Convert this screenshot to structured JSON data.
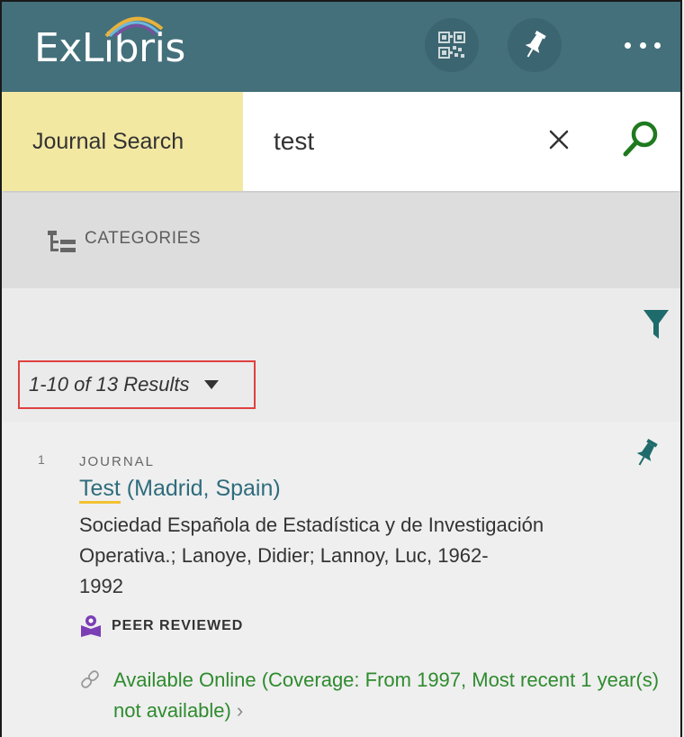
{
  "header": {
    "logo_text": "ExLibris",
    "qr_icon": "qr-code-icon",
    "pin_icon": "pushpin-icon",
    "menu_icon": "more-dots-icon"
  },
  "search": {
    "scope_label": "Journal Search",
    "query": "test",
    "clear_icon": "close-icon",
    "search_icon": "search-icon"
  },
  "categories": {
    "label": "CATEGORIES"
  },
  "results": {
    "count_label": "1-10 of 13 Results"
  },
  "items": [
    {
      "index": "1",
      "type": "JOURNAL",
      "title_highlight": "Test",
      "title_rest": " (Madrid, Spain)",
      "authors": "Sociedad Española de Estadística y de Investigación Operativa.; Lanoye, Didier; Lannoy, Luc, 1962-",
      "year": "1992",
      "peer_reviewed": "PEER REVIEWED",
      "availability": "Available Online (Coverage: From 1997, Most recent 1 year(s) not available)",
      "availability_chevron": "›"
    }
  ],
  "colors": {
    "header_bg": "#44707b",
    "scope_bg": "#f3e8a2",
    "accent_green": "#2e8b2e",
    "title_color": "#2f6c7d",
    "filter_color": "#1f6b6b"
  }
}
